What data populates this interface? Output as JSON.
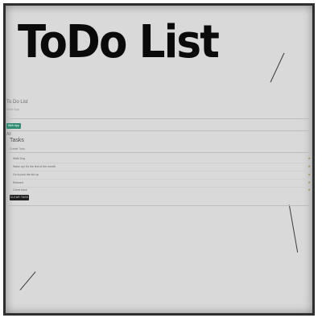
{
  "hero": {
    "title": "ToDo List"
  },
  "app": {
    "title": "To Do List",
    "subtitle": "Web App",
    "tab_label": "Web App",
    "section_label": "All",
    "tasks_heading": "Tasks",
    "input_placeholder": "Create Todo",
    "tasks": [
      {
        "text": "Walk Dog",
        "starred": true
      },
      {
        "text": "Wake up! It's the first of the month",
        "starred": true
      },
      {
        "text": "Go to pick the kid up",
        "starred": true
      },
      {
        "text": "Relaxed",
        "starred": true
      },
      {
        "text": "Come back",
        "starred": true
      }
    ],
    "clear_label": "CLEAR TASK",
    "star_glyph": "★"
  }
}
